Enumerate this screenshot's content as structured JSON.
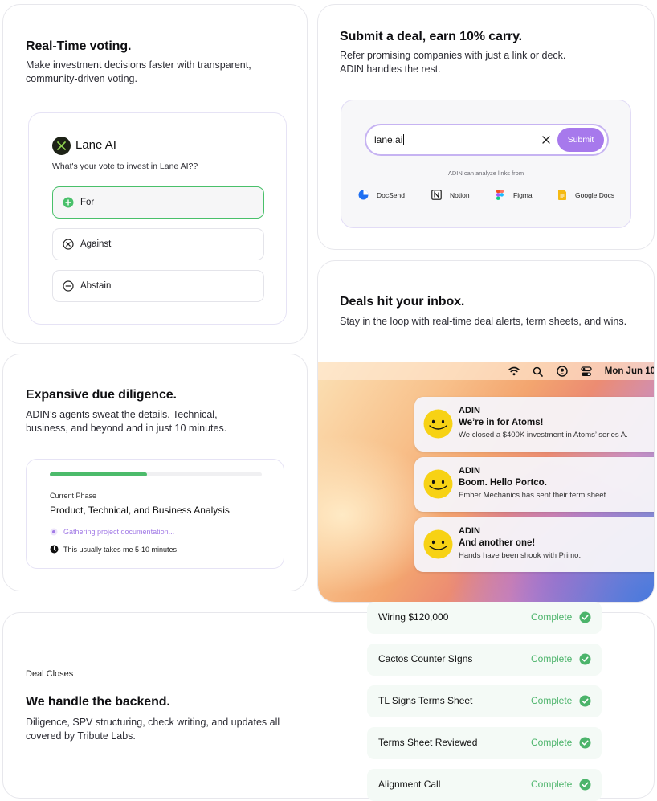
{
  "voting": {
    "title": "Real-Time voting.",
    "description": "Make investment decisions faster with transparent, community-driven voting.",
    "company": "Lane AI",
    "question": "What's your vote to invest in Lane AI??",
    "options": [
      {
        "label": "For",
        "icon": "plus-circle-icon",
        "selected": true
      },
      {
        "label": "Against",
        "icon": "x-circle-icon",
        "selected": false
      },
      {
        "label": "Abstain",
        "icon": "minus-circle-icon",
        "selected": false
      }
    ],
    "accent": "#49c06a"
  },
  "submit": {
    "title": "Submit a deal, earn 10% carry.",
    "description_line1": "Refer promising companies with just a link or deck.",
    "description_line2": "ADIN handles the rest.",
    "url_value": "lane.ai",
    "button_label": "Submit",
    "analyze_note": "ADIN can analyze links from",
    "sources": [
      {
        "label": "DocSend",
        "icon": "docsend-icon"
      },
      {
        "label": "Notion",
        "icon": "notion-icon"
      },
      {
        "label": "Figma",
        "icon": "figma-icon"
      },
      {
        "label": "Google Docs",
        "icon": "google-docs-icon"
      }
    ],
    "accent": "#a779ec"
  },
  "inbox": {
    "title": "Deals hit your inbox.",
    "description": "Stay in the loop with real-time deal alerts, term sheets, and wins.",
    "menubar_date": "Mon Jun 10",
    "menubar_icons": [
      "wifi-icon",
      "search-icon",
      "user-icon",
      "control-center-icon"
    ],
    "notifications": [
      {
        "app": "ADIN",
        "title": "We’re in for Atoms!",
        "body": "We closed a $400K investment in Atoms’ series A."
      },
      {
        "app": "ADIN",
        "title": "Boom. Hello Portco.",
        "body": "Ember Mechanics has sent their term sheet."
      },
      {
        "app": "ADIN",
        "title": "And another one!",
        "body": "Hands have been shook with Primo."
      }
    ]
  },
  "diligence": {
    "title": "Expansive due diligence.",
    "description": "ADIN’s agents sweat the details. Technical, business, and beyond and in just 10 minutes.",
    "progress": 0.46,
    "phase_label": "Current Phase",
    "phase_value": "Product, Technical, and Business Analysis",
    "status": "Gathering project documentation...",
    "time_note": "This usually takes me 5-10 minutes"
  },
  "backend": {
    "eyebrow": "Deal Closes",
    "title": "We handle the backend.",
    "description": "Diligence, SPV structuring, check writing, and updates all covered by Tribute Labs.",
    "tasks": [
      {
        "label": "Wiring $120,000",
        "status": "Complete"
      },
      {
        "label": "Cactos Counter SIgns",
        "status": "Complete"
      },
      {
        "label": "TL Signs Terms Sheet",
        "status": "Complete"
      },
      {
        "label": "Terms Sheet Reviewed",
        "status": "Complete"
      },
      {
        "label": "Alignment Call",
        "status": "Complete"
      }
    ],
    "status_color": "#4cb46b"
  }
}
